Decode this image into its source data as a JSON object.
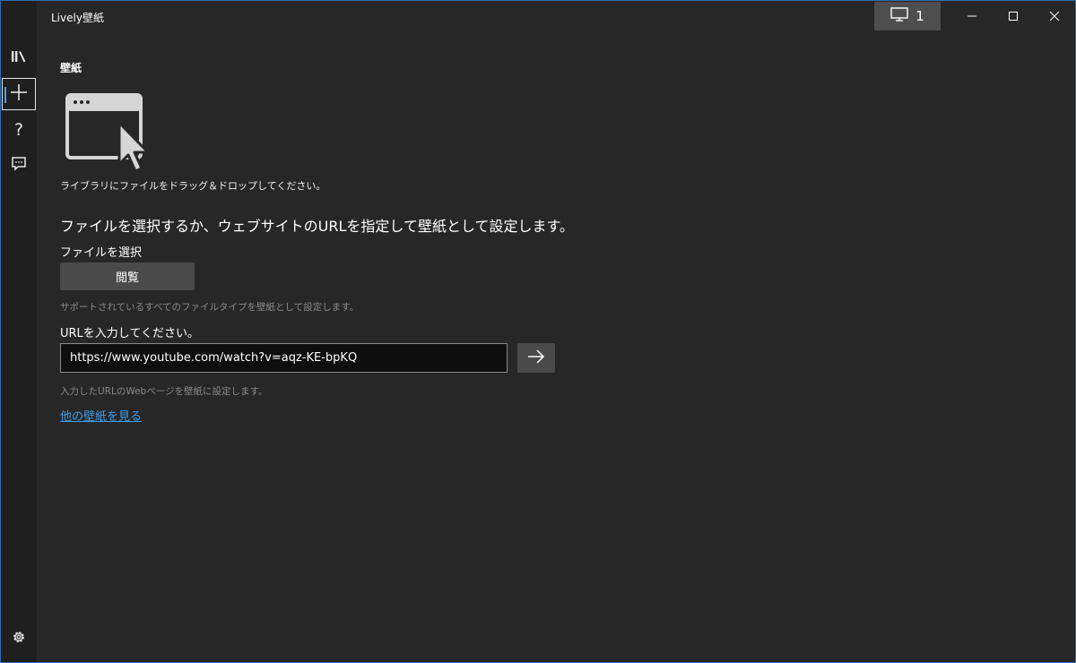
{
  "window": {
    "title": "Lively壁紙"
  },
  "titlebar": {
    "monitor_label": "1",
    "monitor_icon": "monitor-icon",
    "minimize_icon": "minimize-icon",
    "maximize_icon": "maximize-icon",
    "close_icon": "close-icon"
  },
  "sidebar": {
    "items": [
      {
        "name": "library",
        "icon": "library-icon",
        "active": false
      },
      {
        "name": "add-wallpaper",
        "icon": "plus-icon",
        "active": true
      },
      {
        "name": "help",
        "icon": "help-icon",
        "glyph": "?",
        "active": false
      },
      {
        "name": "feedback",
        "icon": "feedback-icon",
        "active": false
      }
    ],
    "settings_icon": "gear-icon",
    "accent": "#4a9eea"
  },
  "main": {
    "section_title": "壁紙",
    "drop_hint": "ライブラリにファイルをドラッグ＆ドロップしてください。",
    "heading": "ファイルを選択するか、ウェブサイトのURLを指定して壁紙として設定します。",
    "file_label": "ファイルを選択",
    "browse_button": "閲覧",
    "file_hint": "サポートされているすべてのファイルタイプを壁紙として設定します。",
    "url_label": "URLを入力してください。",
    "url_value": "https://www.youtube.com/watch?v=aqz-KE-bpKQ",
    "url_hint": "入力したURLのWebページを壁紙に設定します。",
    "more_link": "他の壁紙を見る",
    "link_color": "#3f9ce8"
  }
}
